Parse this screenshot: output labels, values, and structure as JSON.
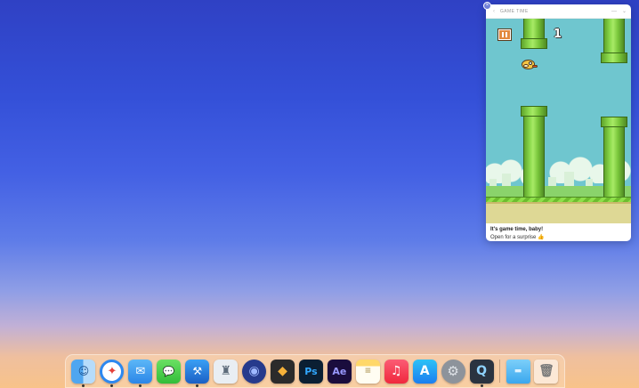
{
  "widget": {
    "title": "GAME TIME",
    "back_icon": "back-arrow-icon",
    "minimize_icon": "minimize-icon",
    "collapse_icon": "chevron-down-icon",
    "close_icon": "close-icon",
    "game": {
      "name": "Flappy Bird",
      "score": "1",
      "pause_icon": "pause-icon"
    },
    "headline": "It's game time, baby!",
    "subtext": "Open for a surprise 👍"
  },
  "dock": {
    "apps": [
      {
        "name": "Finder",
        "icon": "finder-icon",
        "glyph": "☺",
        "cls": "i-finder",
        "running": true
      },
      {
        "name": "Safari",
        "icon": "safari-icon",
        "glyph": "✦",
        "cls": "i-safari",
        "running": true
      },
      {
        "name": "Mail",
        "icon": "mail-icon",
        "glyph": "✉",
        "cls": "i-mail",
        "running": true
      },
      {
        "name": "Messages",
        "icon": "messages-icon",
        "glyph": "💬",
        "cls": "i-messages",
        "running": false
      },
      {
        "name": "Xcode",
        "icon": "xcode-icon",
        "glyph": "⚒",
        "cls": "i-xcode",
        "running": true
      },
      {
        "name": "Tower",
        "icon": "tower-icon",
        "glyph": "♜",
        "cls": "i-tower",
        "running": false
      },
      {
        "name": "Sphere",
        "icon": "sphere-icon",
        "glyph": "◉",
        "cls": "i-sphere",
        "running": false
      },
      {
        "name": "Sketch",
        "icon": "sketch-icon",
        "glyph": "◆",
        "cls": "i-sketch",
        "running": false
      },
      {
        "name": "Photoshop",
        "icon": "photoshop-icon",
        "glyph": "Ps",
        "cls": "i-ps",
        "running": false
      },
      {
        "name": "After Effects",
        "icon": "after-effects-icon",
        "glyph": "Ae",
        "cls": "i-ae",
        "running": false
      },
      {
        "name": "Notes",
        "icon": "notes-icon",
        "glyph": "≡",
        "cls": "i-notes",
        "running": false
      },
      {
        "name": "Music",
        "icon": "music-icon",
        "glyph": "♫",
        "cls": "i-music",
        "running": false
      },
      {
        "name": "App Store",
        "icon": "app-store-icon",
        "glyph": "A",
        "cls": "i-appstore",
        "running": false
      },
      {
        "name": "System Preferences",
        "icon": "settings-gear-icon",
        "glyph": "⚙",
        "cls": "i-settings",
        "running": false
      },
      {
        "name": "QuickTime",
        "icon": "quicktime-icon",
        "glyph": "Q",
        "cls": "i-qt",
        "running": true
      }
    ],
    "extras": [
      {
        "name": "Downloads Folder",
        "icon": "folder-icon",
        "glyph": "▬",
        "cls": "i-folder"
      },
      {
        "name": "Trash",
        "icon": "trash-icon",
        "glyph": "🗑",
        "cls": "i-trash"
      }
    ]
  }
}
